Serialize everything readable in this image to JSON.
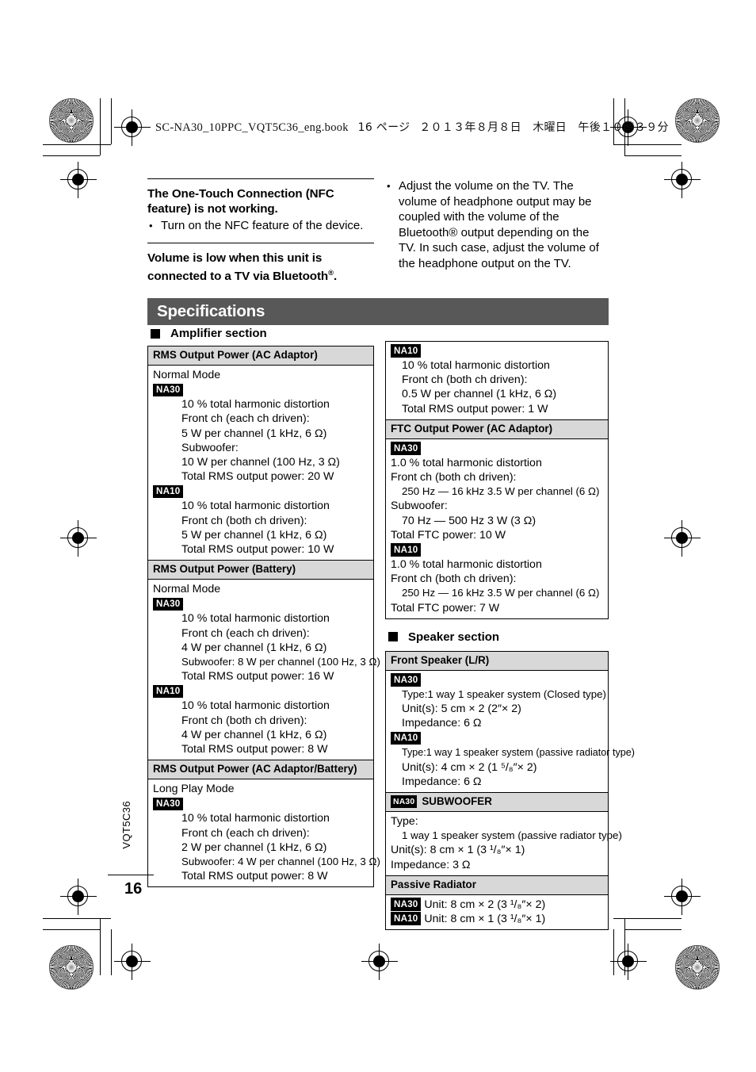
{
  "document": {
    "header_line": "SC-NA30_10PPC_VQT5C36_eng.book",
    "header_page": "16 ページ",
    "header_date": "２０１３年８月８日　木曜日　午後１０時３９分",
    "page_number": "16",
    "doc_code": "VQT5C36"
  },
  "troubleshooting": {
    "q1_title": "The One-Touch Connection (NFC feature) is not working.",
    "q1_bullets": [
      "Turn on the NFC feature of the device."
    ],
    "q2_title_a": "Volume is low when this unit is",
    "q2_title_b": "connected to a TV via Bluetooth",
    "q2_title_sup": "®",
    "q2_title_end": ".",
    "q2_bullet": "Adjust the volume on the TV. The volume of headphone output may be coupled with the volume of the Bluetooth® output depending on the TV. In such case, adjust the volume of the headphone output on the TV."
  },
  "specifications": {
    "banner": "Specifications",
    "amplifier_section": "Amplifier section",
    "speaker_section": "Speaker section",
    "badges": {
      "na30": "NA30",
      "na10": "NA10"
    },
    "tables": {
      "rms_ac": {
        "header": "RMS Output Power (AC Adaptor)",
        "mode": "Normal Mode",
        "na30": [
          "10 % total harmonic distortion",
          "Front ch (each ch driven):",
          "5 W per channel (1 kHz, 6 Ω)",
          "Subwoofer:",
          "10 W per channel (100 Hz, 3 Ω)",
          "Total RMS output power: 20 W"
        ],
        "na10": [
          "10 % total harmonic distortion",
          "Front ch (both ch driven):",
          "5 W per channel (1 kHz, 6 Ω)",
          "Total RMS output power: 10 W"
        ]
      },
      "rms_battery": {
        "header": "RMS Output Power (Battery)",
        "mode": "Normal Mode",
        "na30": [
          "10 % total harmonic distortion",
          "Front ch (each ch driven):",
          "4 W per channel (1 kHz, 6 Ω)",
          "Subwoofer: 8 W per channel (100 Hz, 3 Ω)",
          "Total RMS output power: 16 W"
        ],
        "na10": [
          "10 % total harmonic distortion",
          "Front ch (both ch driven):",
          "4 W per channel (1 kHz, 6 Ω)",
          "Total RMS output power: 8 W"
        ]
      },
      "rms_acbatt": {
        "header": "RMS Output Power (AC Adaptor/Battery)",
        "mode": "Long Play Mode",
        "na30": [
          "10 % total harmonic distortion",
          "Front ch (each ch driven):",
          "2 W per channel (1 kHz, 6 Ω)",
          "Subwoofer: 4 W per channel (100 Hz, 3 Ω)",
          "Total RMS output power: 8 W"
        ]
      },
      "rms_ac_cont_na10": [
        "10 % total harmonic distortion",
        "Front ch (both ch driven):",
        "0.5 W per channel (1 kHz, 6 Ω)",
        "Total RMS output power: 1 W"
      ],
      "ftc_ac": {
        "header": "FTC Output Power (AC Adaptor)",
        "na30": [
          "1.0 % total harmonic distortion",
          "Front ch (both ch driven):",
          "250 Hz — 16 kHz 3.5 W per channel (6 Ω)",
          "Subwoofer:",
          "70 Hz — 500 Hz 3 W (3 Ω)",
          "Total FTC power: 10 W"
        ],
        "na10": [
          "1.0 % total harmonic distortion",
          "Front ch (both ch driven):",
          "250 Hz — 16 kHz 3.5 W per channel (6 Ω)",
          "Total FTC power: 7 W"
        ]
      },
      "front_speaker": {
        "header": "Front Speaker (L/R)",
        "na30": [
          "Type:1 way 1 speaker system (Closed type)",
          "Unit(s): 5 cm × 2 (2″× 2)",
          "Impedance: 6 Ω"
        ],
        "na10": [
          "Type:1 way 1 speaker system (passive radiator type)",
          "Unit(s): 4 cm × 2 (1 ⁵/₈″× 2)",
          "Impedance: 6 Ω"
        ]
      },
      "subwoofer": {
        "header_label": "SUBWOOFER",
        "lines": [
          "Type:",
          "1 way 1 speaker system (passive radiator type)",
          "Unit(s): 8 cm × 1 (3 ¹/₈″× 1)",
          "Impedance: 3 Ω"
        ]
      },
      "passive_radiator": {
        "header": "Passive Radiator",
        "na30_line": "Unit: 8 cm × 2 (3 ¹/₈″× 2)",
        "na10_line": "Unit: 8 cm × 1 (3 ¹/₈″× 1)"
      }
    }
  },
  "colors": {
    "banner_bg": "#585858",
    "table_header_bg": "#d8d8d8",
    "badge_bg": "#000000",
    "text": "#000000"
  }
}
